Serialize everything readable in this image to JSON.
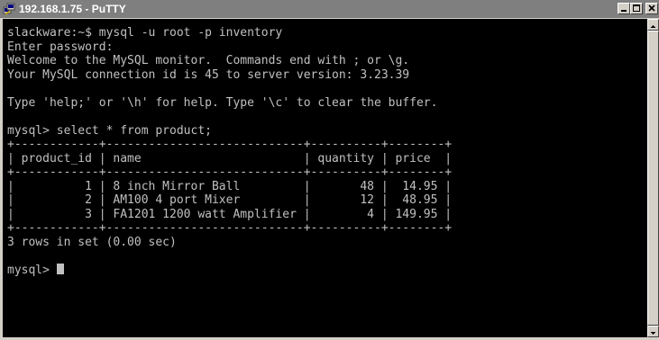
{
  "window": {
    "title": "192.168.1.75 - PuTTY",
    "icons": {
      "app": "putty-app-icon",
      "minimize": "minimize-icon",
      "maximize": "maximize-icon",
      "close": "close-icon"
    },
    "colors": {
      "titlebar_inactive": "#7f7f7f",
      "terminal_bg": "#000000",
      "terminal_fg": "#c0c0c0"
    }
  },
  "terminal": {
    "lines": [
      "slackware:~$ mysql -u root -p inventory",
      "Enter password:",
      "Welcome to the MySQL monitor.  Commands end with ; or \\g.",
      "Your MySQL connection id is 45 to server version: 3.23.39",
      "",
      "Type 'help;' or '\\h' for help. Type '\\c' to clear the buffer.",
      "",
      "mysql> select * from product;",
      "+------------+----------------------------+----------+--------+",
      "| product_id | name                       | quantity | price  |",
      "+------------+----------------------------+----------+--------+",
      "|          1 | 8 inch Mirror Ball         |       48 |  14.95 |",
      "|          2 | AM100 4 port Mixer         |       12 |  48.95 |",
      "|          3 | FA1201 1200 watt Amplifier |        4 | 149.95 |",
      "+------------+----------------------------+----------+--------+",
      "3 rows in set (0.00 sec)",
      "",
      "mysql> "
    ]
  },
  "query_result": {
    "columns": [
      "product_id",
      "name",
      "quantity",
      "price"
    ],
    "rows": [
      [
        "1",
        "8 inch Mirror Ball",
        "48",
        "14.95"
      ],
      [
        "2",
        "AM100 4 port Mixer",
        "12",
        "48.95"
      ],
      [
        "3",
        "FA1201 1200 watt Amplifier",
        "4",
        "149.95"
      ]
    ],
    "summary": "3 rows in set (0.00 sec)"
  },
  "prompt": "mysql> "
}
